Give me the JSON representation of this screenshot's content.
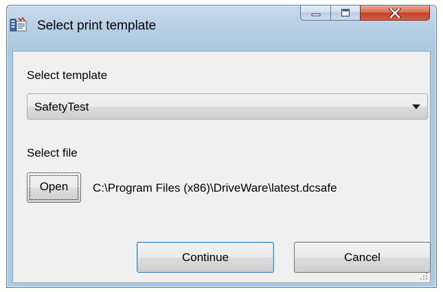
{
  "window": {
    "title": "Select print template",
    "app_icon": "print-template-icon",
    "controls": {
      "minimize_icon": "minimize-icon",
      "maximize_icon": "maximize-icon",
      "close_icon": "close-icon"
    }
  },
  "template": {
    "label": "Select template",
    "selected": "SafetyTest"
  },
  "file": {
    "label": "Select file",
    "open_label": "Open",
    "path": "C:\\Program Files (x86)\\DriveWare\\latest.dcsafe"
  },
  "actions": {
    "continue_label": "Continue",
    "cancel_label": "Cancel"
  },
  "colors": {
    "title_bar": "#b9d0e6",
    "client_bg": "#f0f0f0",
    "close_button": "#c4402a",
    "default_button_border": "#3c7fb1"
  }
}
